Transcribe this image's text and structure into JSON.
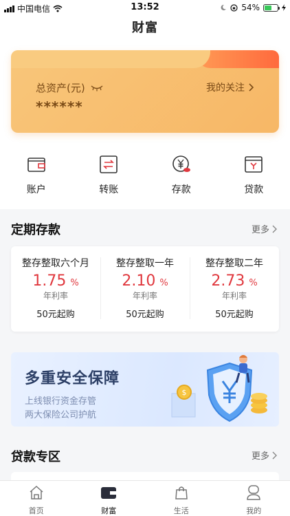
{
  "status_bar": {
    "carrier": "中国电信",
    "time": "13:52",
    "battery": "54%",
    "battery_level": 0.54
  },
  "header": {
    "title": "财富"
  },
  "asset_card": {
    "label": "总资产(元)",
    "value": "******",
    "follow_label": "我的关注"
  },
  "quick_actions": [
    {
      "label": "账户",
      "icon": "wallet-icon"
    },
    {
      "label": "转账",
      "icon": "transfer-icon"
    },
    {
      "label": "存款",
      "icon": "deposit-yen-icon"
    },
    {
      "label": "贷款",
      "icon": "loan-icon"
    }
  ],
  "fixed_deposit": {
    "title": "定期存款",
    "more": "更多",
    "rate_unit": "%",
    "items": [
      {
        "name": "整存整取六个月",
        "rate": "1.75",
        "rate_label": "年利率",
        "min": "50元起购"
      },
      {
        "name": "整存整取一年",
        "rate": "2.10",
        "rate_label": "年利率",
        "min": "50元起购"
      },
      {
        "name": "整存整取二年",
        "rate": "2.73",
        "rate_label": "年利率",
        "min": "50元起购"
      }
    ]
  },
  "banner": {
    "title": "多重安全保障",
    "line1": "上线银行资金存管",
    "line2": "两大保险公司护航"
  },
  "loans": {
    "title": "贷款专区",
    "more": "更多"
  },
  "tab_bar": [
    {
      "label": "首页",
      "icon": "home-icon",
      "active": false
    },
    {
      "label": "财富",
      "icon": "wealth-wallet-icon",
      "active": true
    },
    {
      "label": "生活",
      "icon": "shopping-bag-icon",
      "active": false
    },
    {
      "label": "我的",
      "icon": "profile-icon",
      "active": false
    }
  ],
  "colors": {
    "accent_red": "#e0383e",
    "card_orange": "#f7b766"
  }
}
